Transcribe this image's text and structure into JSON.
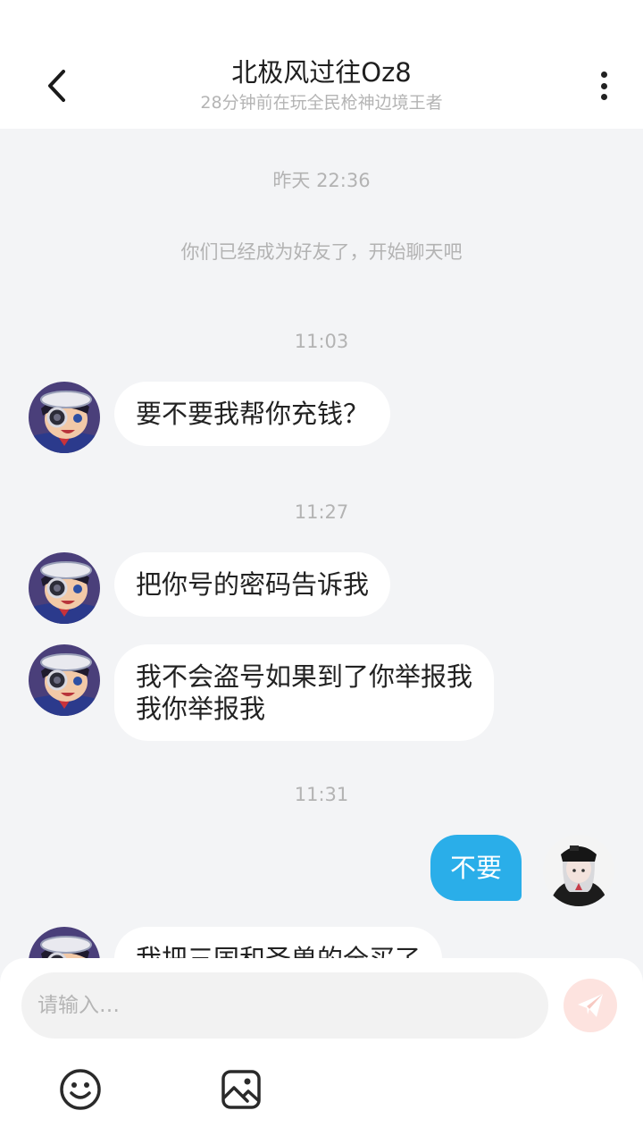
{
  "header": {
    "title": "北极风过往Oz8",
    "subtitle": "28分钟前在玩全民枪神边境王者",
    "back_icon": "chevron-left-icon",
    "more_icon": "more-vertical-icon"
  },
  "chat": {
    "system_time": "昨天 22:36",
    "system_message": "你们已经成为好友了，开始聊天吧",
    "messages": [
      {
        "time": "11:03",
        "sender": "friend",
        "text": "要不要我帮你充钱？"
      },
      {
        "time": "11:27",
        "sender": "friend",
        "text": "把你号的密码告诉我"
      },
      {
        "sender": "friend",
        "text_lines": [
          "我不会盗号如果到了你举报我",
          "我你举报我"
        ]
      },
      {
        "time": "11:31",
        "sender": "me",
        "text": "不要"
      },
      {
        "sender": "friend",
        "text": "我把三国和圣兽的全买了"
      }
    ]
  },
  "composer": {
    "placeholder": "请输入…",
    "send_icon": "paper-plane-icon",
    "emoji_icon": "smiley-icon",
    "image_icon": "image-icon"
  },
  "colors": {
    "background": "#f3f4f6",
    "my_bubble": "#2aaee9",
    "friend_bubble": "#ffffff",
    "send_button_disabled": "#fde3df"
  }
}
